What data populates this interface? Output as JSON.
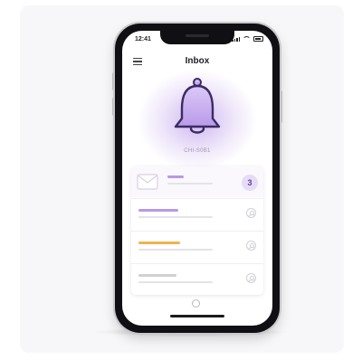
{
  "status_bar": {
    "time": "12:41"
  },
  "header": {
    "title": "Inbox",
    "menu_icon": "hamburger-menu-icon"
  },
  "hero": {
    "icon": "bell-icon",
    "subtitle": "CHI-S0B1"
  },
  "notifications": {
    "featured": {
      "icon": "envelope-icon",
      "count": "3"
    },
    "items": [
      {
        "accent": "#b49ae8"
      },
      {
        "accent": "#f2b34a"
      },
      {
        "accent": "#cfcfd6"
      }
    ]
  },
  "colors": {
    "brand": "#8c6ad6",
    "badge_text": "#5e3fa8",
    "badge_bg": "#e6dcf6"
  }
}
